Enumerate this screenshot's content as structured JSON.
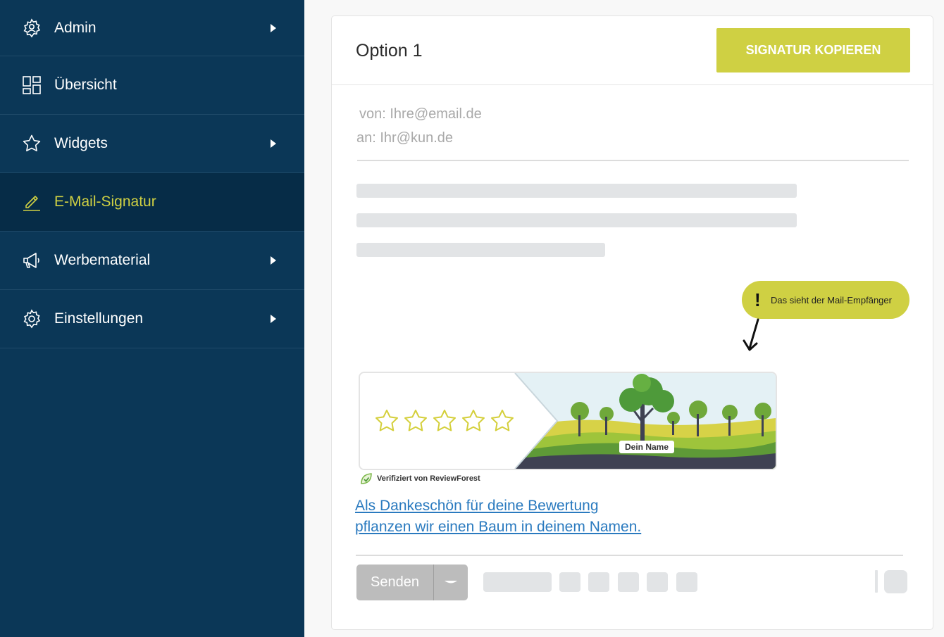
{
  "sidebar": {
    "items": [
      {
        "label": "Admin",
        "icon": "admin-gear-user-icon",
        "has_arrow": true
      },
      {
        "label": "Übersicht",
        "icon": "dashboard-grid-icon",
        "has_arrow": false
      },
      {
        "label": "Widgets",
        "icon": "star-icon",
        "has_arrow": true
      },
      {
        "label": "E-Mail-Signatur",
        "icon": "pen-icon",
        "has_arrow": false,
        "active": true
      },
      {
        "label": "Werbematerial",
        "icon": "megaphone-icon",
        "has_arrow": true
      },
      {
        "label": "Einstellungen",
        "icon": "gear-icon",
        "has_arrow": true
      }
    ]
  },
  "card": {
    "title": "Option 1",
    "copy_button": "SIGNATUR KOPIEREN"
  },
  "email": {
    "from": "von: Ihre@email.de",
    "to": "an: Ihr@kun.de"
  },
  "callout": {
    "mark": "!",
    "text": "Das sieht der Mail-Empfänger"
  },
  "banner": {
    "stars": 5,
    "name_label": "Dein Name",
    "verified": "Verifiziert von ReviewForest"
  },
  "link": {
    "line1": "Als Dankeschön für deine Bewertung",
    "line2": "pflanzen wir einen Baum in deinem Namen."
  },
  "composer": {
    "send_label": "Senden"
  },
  "colors": {
    "sidebar_bg": "#0b3757",
    "sidebar_active_bg": "#062c47",
    "accent": "#cfd043",
    "link": "#2a7abf"
  }
}
